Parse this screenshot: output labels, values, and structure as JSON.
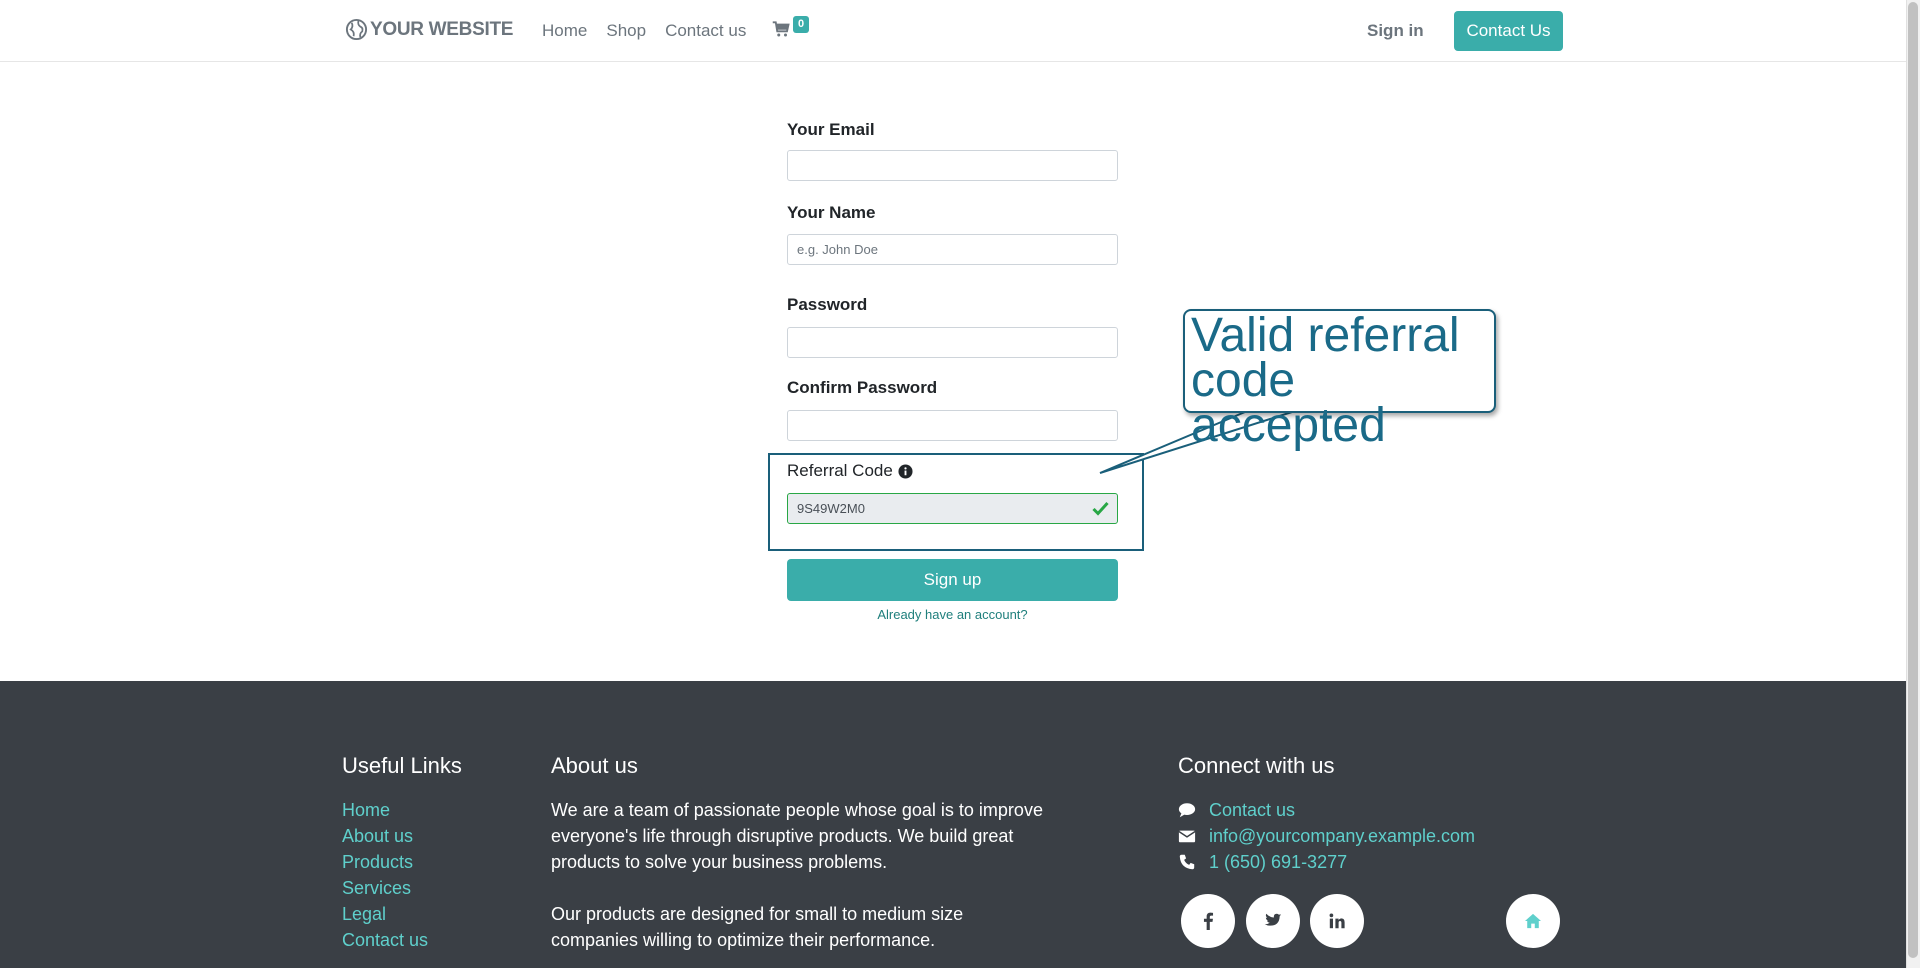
{
  "header": {
    "logo_text": "YOUR WEBSITE",
    "nav": [
      "Home",
      "Shop",
      "Contact us"
    ],
    "cart_count": "0",
    "signin_label": "Sign in",
    "contact_button": "Contact Us"
  },
  "form": {
    "email_label": "Your Email",
    "email_value": "",
    "name_label": "Your Name",
    "name_placeholder": "e.g. John Doe",
    "password_label": "Password",
    "confirm_label": "Confirm Password",
    "referral_label": "Referral Code",
    "referral_value": "9S49W2M0",
    "signup_button": "Sign up",
    "already_link": "Already have an account?"
  },
  "annotation": {
    "callout_line1": "Valid referral",
    "callout_line2": "code accepted"
  },
  "footer": {
    "useful_links_title": "Useful Links",
    "useful_links": [
      "Home",
      "About us",
      "Products",
      "Services",
      "Legal",
      "Contact us"
    ],
    "about_title": "About us",
    "about_p1": "We are a team of passionate people whose goal is to improve everyone's life through disruptive products. We build great products to solve your business problems.",
    "about_p2": "Our products are designed for small to medium size companies willing to optimize their performance.",
    "connect_title": "Connect with us",
    "connect_contact": "Contact us",
    "connect_email": "info@yourcompany.example.com",
    "connect_phone": "1 (650) 691-3277"
  },
  "colors": {
    "accent": "#3aadaa",
    "footer_bg": "#3a3f45",
    "link": "#5fd0cc",
    "annotation": "#1a5f7a"
  },
  "icons": {
    "social": [
      "facebook-icon",
      "twitter-icon",
      "linkedin-icon",
      "home-icon"
    ]
  }
}
